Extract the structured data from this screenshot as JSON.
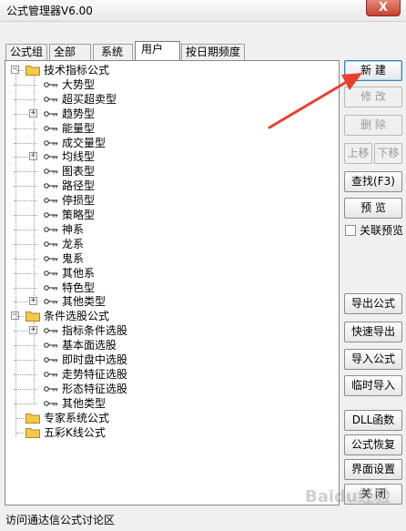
{
  "window": {
    "title": "公式管理器V6.00",
    "close_label": "X"
  },
  "tabs": [
    "公式组",
    "全部",
    "系统",
    "用户",
    "按日期频度"
  ],
  "tree": {
    "groups": [
      {
        "label": "技术指标公式",
        "items": [
          "大势型",
          "超买超卖型",
          "趋势型",
          "能量型",
          "成交量型",
          "均线型",
          "图表型",
          "路径型",
          "停损型",
          "策略型",
          "神系",
          "龙系",
          "鬼系",
          "其他系",
          "特色型",
          "其他类型"
        ]
      },
      {
        "label": "条件选股公式",
        "items": [
          "指标条件选股",
          "基本面选股",
          "即时盘中选股",
          "走势特征选股",
          "形态特征选股",
          "其他类型"
        ]
      },
      {
        "label": "专家系统公式",
        "items": []
      },
      {
        "label": "五彩K线公式",
        "items": []
      }
    ]
  },
  "buttons": {
    "new": "新 建",
    "edit": "修 改",
    "delete": "删 除",
    "move_up": "上移",
    "move_down": "下移",
    "find": "查找(F3)",
    "preview": "预 览",
    "linked_preview": "关联预览",
    "export": "导出公式",
    "quick_export": "快速导出",
    "import": "导入公式",
    "temp_import": "临时导入",
    "dll": "DLL函数",
    "restore": "公式恢复",
    "interface": "界面设置",
    "close": "关 闭"
  },
  "status": {
    "text": "访问通达信公式讨论区"
  },
  "watermark": "Baidu经验",
  "colors": {
    "arrow": "#e8402f",
    "folder": "#f2c94c",
    "titlebar": "#ececec"
  }
}
